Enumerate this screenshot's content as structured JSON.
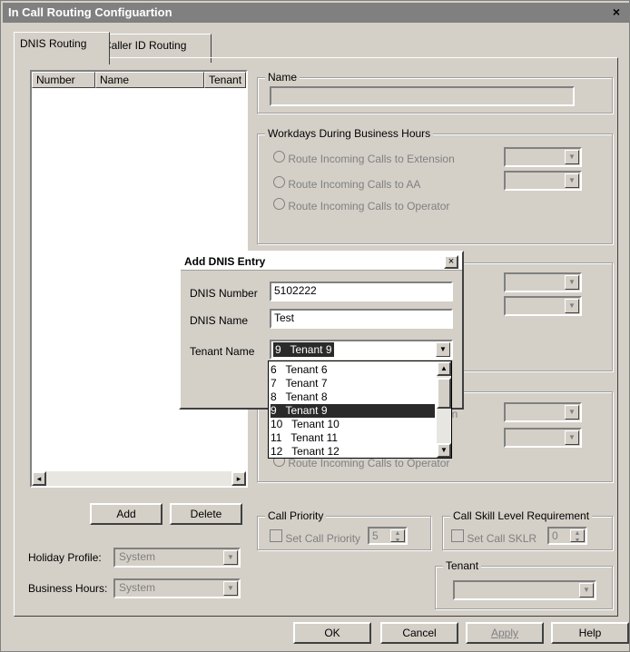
{
  "window": {
    "title": "In Call Routing Configuartion",
    "close": "×"
  },
  "tabs": [
    {
      "label": "DNIS Routing",
      "active": true
    },
    {
      "label": "Caller ID Routing",
      "active": false
    }
  ],
  "list": {
    "columns": [
      "Number",
      "Name",
      "Tenant"
    ],
    "scroll_left": "◂",
    "scroll_right": "▸"
  },
  "buttons": {
    "add": "Add",
    "delete": "Delete",
    "ok": "OK",
    "cancel": "Cancel",
    "apply": "Apply",
    "help": "Help"
  },
  "holiday_profile": {
    "label": "Holiday Profile:",
    "value": "System"
  },
  "business_hours": {
    "label": "Business Hours:",
    "value": "System"
  },
  "name_group": {
    "legend": "Name",
    "value": ""
  },
  "workdays_group": {
    "legend": "Workdays During Business Hours",
    "options": [
      "Route Incoming Calls to Extension",
      "Route Incoming Calls to AA",
      "Route Incoming Calls to Operator"
    ]
  },
  "hidden_group3_partial": {
    "option_partial": "Route Incoming Calls to Operator",
    "text_partial": "on"
  },
  "call_priority": {
    "legend": "Call Priority",
    "checkbox": "Set Call Priority",
    "value": "5"
  },
  "skill": {
    "legend": "Call Skill Level Requirement",
    "checkbox": "Set Call SKLR",
    "value": "0"
  },
  "tenant_group": {
    "legend": "Tenant",
    "value": ""
  },
  "dialog": {
    "title": "Add DNIS Entry",
    "close": "×",
    "dnis_number_label": "DNIS Number",
    "dnis_number_value": "5102222",
    "dnis_name_label": "DNIS Name",
    "dnis_name_value": "Test",
    "tenant_label": "Tenant Name",
    "tenant_value": "9   Tenant 9",
    "options": [
      "6   Tenant 6",
      "7   Tenant 7",
      "8   Tenant 8",
      "9   Tenant 9",
      "10   Tenant 10",
      "11   Tenant 11",
      "12   Tenant 12"
    ],
    "selected_index": 3
  },
  "colors": {
    "face": "#d4d0c8",
    "selection": "#2a2a2a",
    "title_bg": "#808080"
  }
}
